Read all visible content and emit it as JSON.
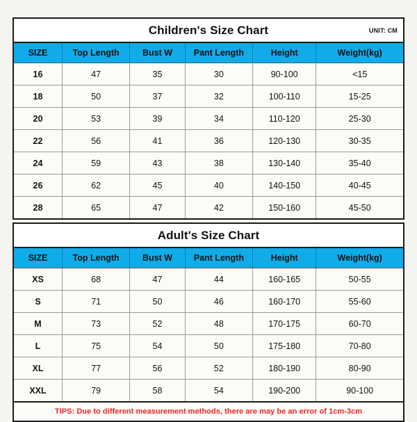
{
  "page": {
    "background_color": "#f4f4f0",
    "header_color": "#10ace9",
    "tips_color": "#ef2626"
  },
  "children_chart": {
    "title": "Children's Size Chart",
    "unit_label": "UNIT: CM",
    "columns": [
      "SIZE",
      "Top Length",
      "Bust W",
      "Pant Length",
      "Height",
      "Weight(kg)"
    ],
    "rows": [
      [
        "16",
        "47",
        "35",
        "30",
        "90-100",
        "<15"
      ],
      [
        "18",
        "50",
        "37",
        "32",
        "100-110",
        "15-25"
      ],
      [
        "20",
        "53",
        "39",
        "34",
        "110-120",
        "25-30"
      ],
      [
        "22",
        "56",
        "41",
        "36",
        "120-130",
        "30-35"
      ],
      [
        "24",
        "59",
        "43",
        "38",
        "130-140",
        "35-40"
      ],
      [
        "26",
        "62",
        "45",
        "40",
        "140-150",
        "40-45"
      ],
      [
        "28",
        "65",
        "47",
        "42",
        "150-160",
        "45-50"
      ]
    ]
  },
  "adult_chart": {
    "title": "Adult's Size Chart",
    "columns": [
      "SIZE",
      "Top Length",
      "Bust W",
      "Pant Length",
      "Height",
      "Weight(kg)"
    ],
    "rows": [
      [
        "XS",
        "68",
        "47",
        "44",
        "160-165",
        "50-55"
      ],
      [
        "S",
        "71",
        "50",
        "46",
        "160-170",
        "55-60"
      ],
      [
        "M",
        "73",
        "52",
        "48",
        "170-175",
        "60-70"
      ],
      [
        "L",
        "75",
        "54",
        "50",
        "175-180",
        "70-80"
      ],
      [
        "XL",
        "77",
        "56",
        "52",
        "180-190",
        "80-90"
      ],
      [
        "XXL",
        "79",
        "58",
        "54",
        "190-200",
        "90-100"
      ]
    ],
    "tips": "TIPS: Due to different measurement methods, there are may be an error of 1cm-3cm"
  },
  "chart_data": {
    "type": "table",
    "title": "Children's and Adult's Size Chart",
    "unit": "CM",
    "tables": [
      {
        "name": "Children's Size Chart",
        "columns": [
          "SIZE",
          "Top Length",
          "Bust W",
          "Pant Length",
          "Height",
          "Weight(kg)"
        ],
        "rows": [
          [
            "16",
            "47",
            "35",
            "30",
            "90-100",
            "<15"
          ],
          [
            "18",
            "50",
            "37",
            "32",
            "100-110",
            "15-25"
          ],
          [
            "20",
            "53",
            "39",
            "34",
            "110-120",
            "25-30"
          ],
          [
            "22",
            "56",
            "41",
            "36",
            "120-130",
            "30-35"
          ],
          [
            "24",
            "59",
            "43",
            "38",
            "130-140",
            "35-40"
          ],
          [
            "26",
            "62",
            "45",
            "40",
            "140-150",
            "40-45"
          ],
          [
            "28",
            "65",
            "47",
            "42",
            "150-160",
            "45-50"
          ]
        ]
      },
      {
        "name": "Adult's Size Chart",
        "columns": [
          "SIZE",
          "Top Length",
          "Bust W",
          "Pant Length",
          "Height",
          "Weight(kg)"
        ],
        "rows": [
          [
            "XS",
            "68",
            "47",
            "44",
            "160-165",
            "50-55"
          ],
          [
            "S",
            "71",
            "50",
            "46",
            "160-170",
            "55-60"
          ],
          [
            "M",
            "73",
            "52",
            "48",
            "170-175",
            "60-70"
          ],
          [
            "L",
            "75",
            "54",
            "50",
            "175-180",
            "70-80"
          ],
          [
            "XL",
            "77",
            "56",
            "52",
            "180-190",
            "80-90"
          ],
          [
            "XXL",
            "79",
            "58",
            "54",
            "190-200",
            "90-100"
          ]
        ]
      }
    ],
    "note": "TIPS: Due to different measurement methods, there are may be an error of 1cm-3cm"
  }
}
